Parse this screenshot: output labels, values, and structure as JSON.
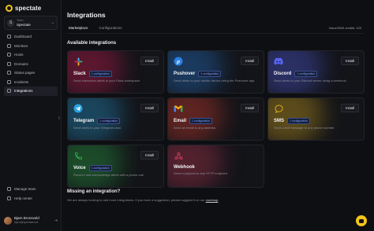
{
  "app": {
    "logo_text": "spectate"
  },
  "team": {
    "label": "Team",
    "name": "Spectate",
    "avatar_letter": "S"
  },
  "sidebar": {
    "items": [
      {
        "label": "Dashboard",
        "icon": "dashboard-icon",
        "active": false
      },
      {
        "label": "Monitors",
        "icon": "monitor-icon",
        "active": false
      },
      {
        "label": "Hosts",
        "icon": "server-icon",
        "active": false
      },
      {
        "label": "Domains",
        "icon": "globe-icon",
        "active": false
      },
      {
        "label": "Status pages",
        "icon": "status-page-icon",
        "active": false
      },
      {
        "label": "Incidents",
        "icon": "incident-icon",
        "active": false
      },
      {
        "label": "Integrations",
        "icon": "puzzle-icon",
        "active": true
      }
    ],
    "bottom_items": [
      {
        "label": "Manage team",
        "icon": "team-icon"
      },
      {
        "label": "Help center",
        "icon": "help-icon"
      }
    ]
  },
  "user": {
    "name": "Bjarn Bronsveld",
    "email": "bjarn@spectate.net"
  },
  "page": {
    "title": "Integrations",
    "tabs": [
      {
        "label": "Marketplace",
        "active": true
      },
      {
        "label": "Configurations",
        "active": false
      }
    ],
    "credits": "Voice/SMS credits: 120"
  },
  "available": {
    "title": "Available integrations",
    "install_label": "Install",
    "items": [
      {
        "name": "Slack",
        "badge": "1 configuration",
        "desc": "Send interactive alerts to your Slack workspace.",
        "icon": "slack-icon",
        "color": "#e01e5a"
      },
      {
        "name": "Pushover",
        "badge": "1 configuration",
        "desc": "Send alerts to your mobile device using the Pushover app.",
        "icon": "pushover-icon",
        "color": "#2a7fe0"
      },
      {
        "name": "Discord",
        "badge": "1 configuration",
        "desc": "Send alerts to your Discord server using a webhook.",
        "icon": "discord-icon",
        "color": "#5865f2"
      },
      {
        "name": "Telegram",
        "badge": "1 configuration",
        "desc": "Send alerts to your Telegram chat.",
        "icon": "telegram-icon",
        "color": "#2aa3df"
      },
      {
        "name": "Email",
        "badge": "1 configuration",
        "desc": "Send an email to any address.",
        "icon": "gmail-icon",
        "color": "#ea4335"
      },
      {
        "name": "SMS",
        "badge": "1 configuration",
        "desc": "Send a text message to any phone number.",
        "icon": "sms-icon",
        "color": "#e6b422"
      },
      {
        "name": "Voice",
        "badge": "1 configuration",
        "desc": "Receive and acknowledge alerts with a phone call.",
        "icon": "phone-icon",
        "color": "#2fb24c"
      },
      {
        "name": "Webhook",
        "badge": "",
        "desc": "Send a payload to any HTTP endpoint.",
        "icon": "webhook-icon",
        "color": "#c73b5a"
      }
    ]
  },
  "missing": {
    "title": "Missing an integration?",
    "text": "We are always looking to add more integrations. If you have a suggestion, please suggest it on our",
    "link": "roadmap"
  }
}
